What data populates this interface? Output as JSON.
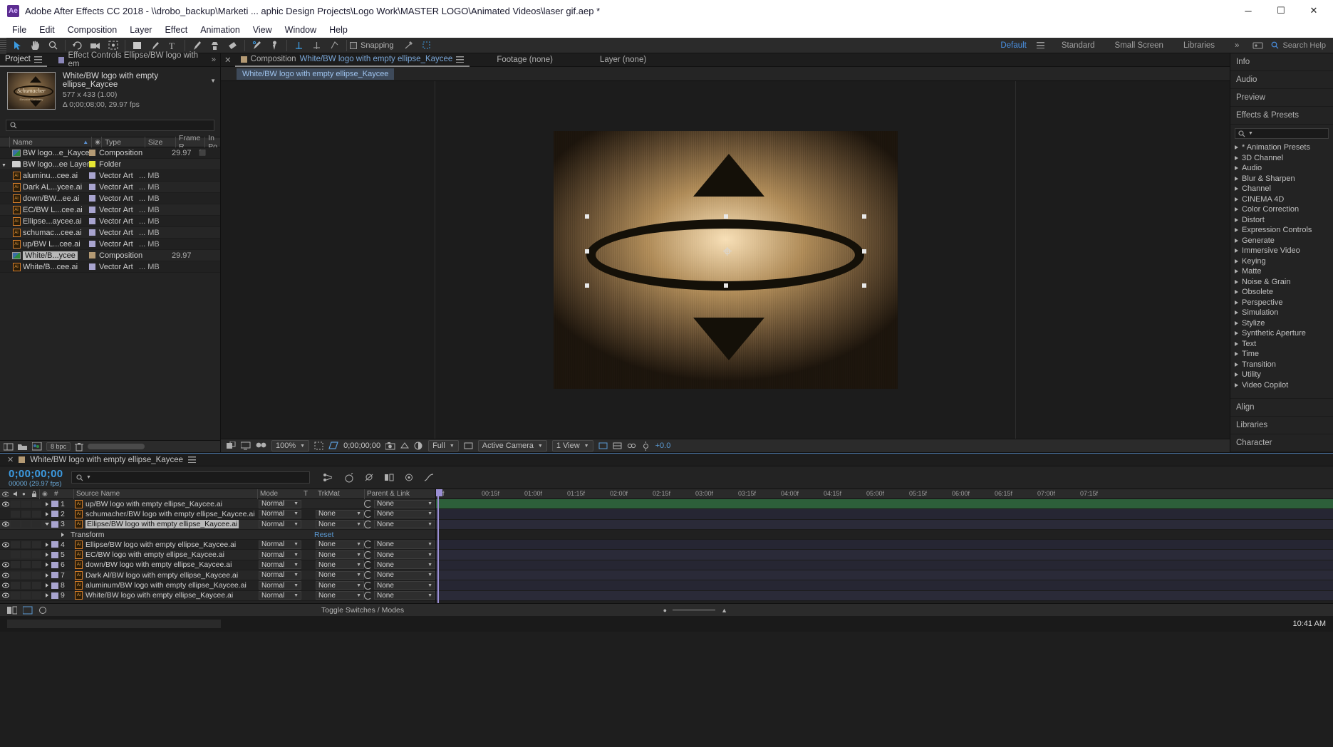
{
  "window": {
    "app_badge": "Ae",
    "title": "Adobe After Effects CC 2018 - \\\\drobo_backup\\Marketi ... aphic Design Projects\\Logo Work\\MASTER LOGO\\Animated Videos\\laser gif.aep *",
    "minimize": "─",
    "maximize": "☐",
    "close": "✕"
  },
  "menubar": [
    "File",
    "Edit",
    "Composition",
    "Layer",
    "Effect",
    "Animation",
    "View",
    "Window",
    "Help"
  ],
  "toolbar": {
    "snapping_label": "Snapping",
    "workspaces": [
      {
        "label": "Default",
        "active": true
      },
      {
        "label": "Standard",
        "active": false
      },
      {
        "label": "Small Screen",
        "active": false
      },
      {
        "label": "Libraries",
        "active": false
      }
    ],
    "overflow": "»",
    "search_help": "Search Help"
  },
  "project_panel": {
    "tabs": [
      {
        "label": "Project",
        "active": true
      },
      {
        "label": "Effect Controls Ellipse/BW logo with em",
        "active": false
      }
    ],
    "preview": {
      "name": "White/BW logo with empty ellipse_Kaycee",
      "dimensions": "577 x 433 (1.00)",
      "duration": "Δ 0;00;08;00, 29.97 fps",
      "thumb_text": "Schumacher",
      "thumb_subtext": "Elevator Company"
    },
    "search_placeholder": "",
    "columns": [
      "Name",
      "Type",
      "Size",
      "Frame R...",
      "In Po"
    ],
    "rows": [
      {
        "indent": 0,
        "icon": "composition",
        "name": "BW logo...e_Kaycee",
        "label_color": "#b49a74",
        "type": "Composition",
        "size": "",
        "framerate": "29.97",
        "in_point": "⬛"
      },
      {
        "indent": 0,
        "icon": "folder",
        "name": "BW logo...ee Layers",
        "label_color": "#e5e533",
        "type": "Folder",
        "size": "",
        "framerate": "",
        "in_point": ""
      },
      {
        "indent": 1,
        "icon": "ai",
        "name": "aluminu...cee.ai",
        "label_color": "#a8a4cf",
        "type": "Vector Art",
        "size": "... MB",
        "framerate": "",
        "in_point": ""
      },
      {
        "indent": 1,
        "icon": "ai",
        "name": "Dark AL...ycee.ai",
        "label_color": "#a8a4cf",
        "type": "Vector Art",
        "size": "... MB",
        "framerate": "",
        "in_point": ""
      },
      {
        "indent": 1,
        "icon": "ai",
        "name": "down/BW...ee.ai",
        "label_color": "#a8a4cf",
        "type": "Vector Art",
        "size": "... MB",
        "framerate": "",
        "in_point": ""
      },
      {
        "indent": 1,
        "icon": "ai",
        "name": "EC/BW L...cee.ai",
        "label_color": "#a8a4cf",
        "type": "Vector Art",
        "size": "... MB",
        "framerate": "",
        "in_point": ""
      },
      {
        "indent": 1,
        "icon": "ai",
        "name": "Ellipse...aycee.ai",
        "label_color": "#a8a4cf",
        "type": "Vector Art",
        "size": "... MB",
        "framerate": "",
        "in_point": ""
      },
      {
        "indent": 1,
        "icon": "ai",
        "name": "schumac...cee.ai",
        "label_color": "#a8a4cf",
        "type": "Vector Art",
        "size": "... MB",
        "framerate": "",
        "in_point": ""
      },
      {
        "indent": 1,
        "icon": "ai",
        "name": "up/BW L...cee.ai",
        "label_color": "#a8a4cf",
        "type": "Vector Art",
        "size": "... MB",
        "framerate": "",
        "in_point": ""
      },
      {
        "indent": 1,
        "icon": "composition",
        "name": "White/B...ycee",
        "label_color": "#b49a74",
        "type": "Composition",
        "size": "",
        "framerate": "29.97",
        "in_point": "",
        "selected": true
      },
      {
        "indent": 1,
        "icon": "ai",
        "name": "White/B...cee.ai",
        "label_color": "#a8a4cf",
        "type": "Vector Art",
        "size": "... MB",
        "framerate": "",
        "in_point": ""
      }
    ],
    "footer": {
      "bit_depth": "8 bpc"
    }
  },
  "comp_panel": {
    "tabs": [
      {
        "label": "Composition",
        "accent": "White/BW logo with empty ellipse_Kaycee",
        "active": true
      },
      {
        "label": "Footage (none)",
        "accent": "",
        "active": false
      },
      {
        "label": "Layer (none)",
        "accent": "",
        "active": false
      }
    ],
    "breadcrumb": "White/BW logo with empty ellipse_Kaycee",
    "bottom": {
      "zoom": "100%",
      "timecode": "0;00;00;00",
      "resolution": "Full",
      "camera": "Active Camera",
      "views": "1 View",
      "exposure": "+0.0"
    }
  },
  "right_panel": {
    "panels": [
      "Info",
      "Audio",
      "Preview",
      "Effects & Presets"
    ],
    "search_placeholder": "",
    "categories": [
      "* Animation Presets",
      "3D Channel",
      "Audio",
      "Blur & Sharpen",
      "Channel",
      "CINEMA 4D",
      "Color Correction",
      "Distort",
      "Expression Controls",
      "Generate",
      "Immersive Video",
      "Keying",
      "Matte",
      "Noise & Grain",
      "Obsolete",
      "Perspective",
      "Simulation",
      "Stylize",
      "Synthetic Aperture",
      "Text",
      "Time",
      "Transition",
      "Utility",
      "Video Copilot"
    ],
    "footer_panels": [
      "Align",
      "Libraries",
      "Character"
    ]
  },
  "timeline": {
    "tab_label": "White/BW logo with empty ellipse_Kaycee",
    "current_time": "0;00;00;00",
    "frame_info": "00000 (29.97 fps)",
    "search_placeholder": "",
    "columns": [
      "#",
      "Source Name",
      "Mode",
      "T",
      "TrkMat",
      "Parent & Link"
    ],
    "ruler_ticks": [
      "0f",
      "00:15f",
      "01:00f",
      "01:15f",
      "02:00f",
      "02:15f",
      "03:00f",
      "03:15f",
      "04:00f",
      "04:15f",
      "05:00f",
      "05:15f",
      "06:00f",
      "06:15f",
      "07:00f",
      "07:15f"
    ],
    "layers": [
      {
        "num": "1",
        "name": "up/BW logo with empty ellipse_Kaycee.ai",
        "mode": "Normal",
        "trkmat": "",
        "parent": "None",
        "visible": true,
        "expanded": false,
        "selected": false,
        "track": "green"
      },
      {
        "num": "2",
        "name": "schumacher/BW logo with empty ellipse_Kaycee.ai",
        "mode": "Normal",
        "trkmat": "None",
        "parent": "None",
        "visible": false,
        "expanded": false,
        "selected": false,
        "track": "purple"
      },
      {
        "num": "3",
        "name": "Ellipse/BW logo with empty ellipse_Kaycee.ai",
        "mode": "Normal",
        "trkmat": "None",
        "parent": "None",
        "visible": true,
        "expanded": true,
        "selected": true,
        "track": "purple"
      },
      {
        "num": "4",
        "name": "Ellipse/BW logo with empty ellipse_Kaycee.ai",
        "mode": "Normal",
        "trkmat": "None",
        "parent": "None",
        "visible": true,
        "expanded": false,
        "selected": false,
        "track": "purple"
      },
      {
        "num": "5",
        "name": "EC/BW logo with empty ellipse_Kaycee.ai",
        "mode": "Normal",
        "trkmat": "None",
        "parent": "None",
        "visible": false,
        "expanded": false,
        "selected": false,
        "track": "purple"
      },
      {
        "num": "6",
        "name": "down/BW logo with empty ellipse_Kaycee.ai",
        "mode": "Normal",
        "trkmat": "None",
        "parent": "None",
        "visible": true,
        "expanded": false,
        "selected": false,
        "track": "purple"
      },
      {
        "num": "7",
        "name": "Dark Al/BW logo with empty ellipse_Kaycee.ai",
        "mode": "Normal",
        "trkmat": "None",
        "parent": "None",
        "visible": true,
        "expanded": false,
        "selected": false,
        "track": "purple"
      },
      {
        "num": "8",
        "name": "aluminum/BW logo with empty ellipse_Kaycee.ai",
        "mode": "Normal",
        "trkmat": "None",
        "parent": "None",
        "visible": true,
        "expanded": false,
        "selected": false,
        "track": "purple"
      },
      {
        "num": "9",
        "name": "White/BW logo with empty ellipse_Kaycee.ai",
        "mode": "Normal",
        "trkmat": "None",
        "parent": "None",
        "visible": true,
        "expanded": false,
        "selected": false,
        "track": "purple"
      }
    ],
    "transform_row": {
      "label": "Transform",
      "reset": "Reset"
    },
    "footer_label": "Toggle Switches / Modes"
  },
  "taskbar": {
    "clock": "10:41 AM"
  }
}
